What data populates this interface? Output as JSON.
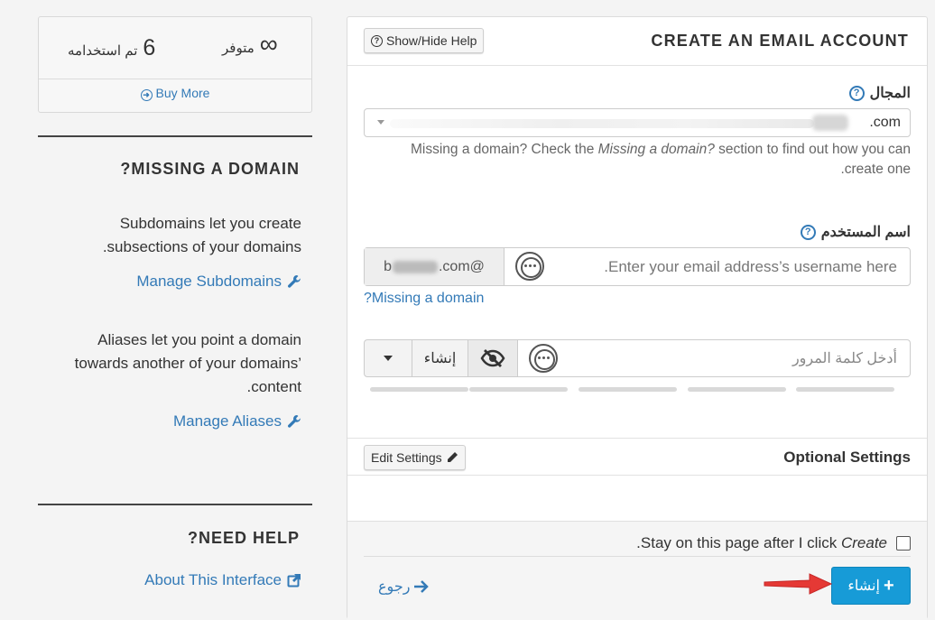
{
  "stats": {
    "used_num": "6",
    "used_label": "تم استخدامه",
    "avail_num": "∞",
    "avail_label": "متوفر",
    "buy_more": "Buy More"
  },
  "missing_domain": {
    "title": "MISSING A DOMAIN?",
    "subdomains_text": "Subdomains let you create subsections of your domains.",
    "subdomains_link": "Manage Subdomains",
    "aliases_text": "Aliases let you point a domain towards another of your domains’ content.",
    "aliases_link": "Manage Aliases"
  },
  "need_help": {
    "title": "NEED HELP?",
    "link": "About This Interface"
  },
  "panel": {
    "title": "CREATE AN EMAIL ACCOUNT",
    "show_hide_help": "Show/Hide Help",
    "domain_label": "المجال",
    "domain_value": ".com",
    "domain_help_prefix": "Missing a domain? Check the ",
    "domain_help_em": "Missing a domain?",
    "domain_help_suffix": " section to find out how you can create one.",
    "username_label": "اسم المستخدم",
    "username_addon_prefix": "b",
    "username_addon_suffix": ".com@",
    "username_placeholder": "Enter your email address’s username here.",
    "missing_domain_link": "Missing a domain?",
    "password_placeholder": "أدخل كلمة المرور",
    "generate_label": "إنشاء",
    "optional_settings": "Optional Settings",
    "edit_settings": "Edit Settings",
    "stay_prefix": "Stay on this page after I click ",
    "stay_em": "Create",
    "stay_suffix": ".",
    "stay_checked": false,
    "back_label": "رجوع",
    "create_label": "إنشاء"
  },
  "colors": {
    "link": "#337ab7",
    "primary_button": "#179bd7",
    "annotation_arrow": "#e53935"
  }
}
